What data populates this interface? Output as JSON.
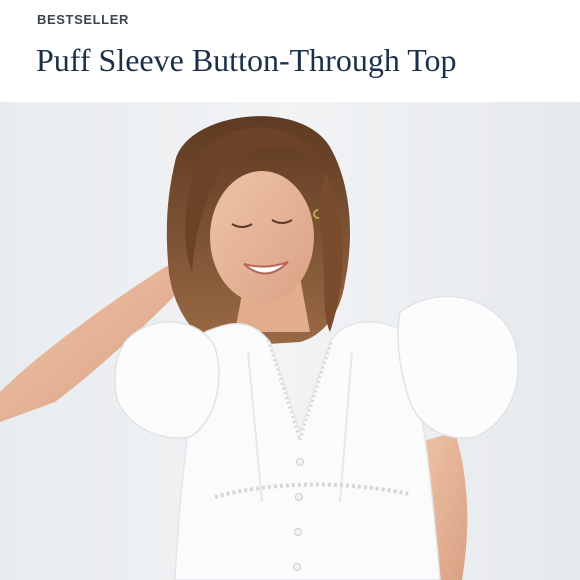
{
  "product": {
    "badge": "BESTSELLER",
    "title": "Puff Sleeve Button-Through Top"
  },
  "image": {
    "alt": "Model smiling with hand in hair, wearing a white puff sleeve button-through top with lace trim",
    "colors": {
      "background": "#eef0f2",
      "garment": "#fbfbfb",
      "skin": "#e7b79a",
      "hair": "#7a4b2c"
    }
  }
}
